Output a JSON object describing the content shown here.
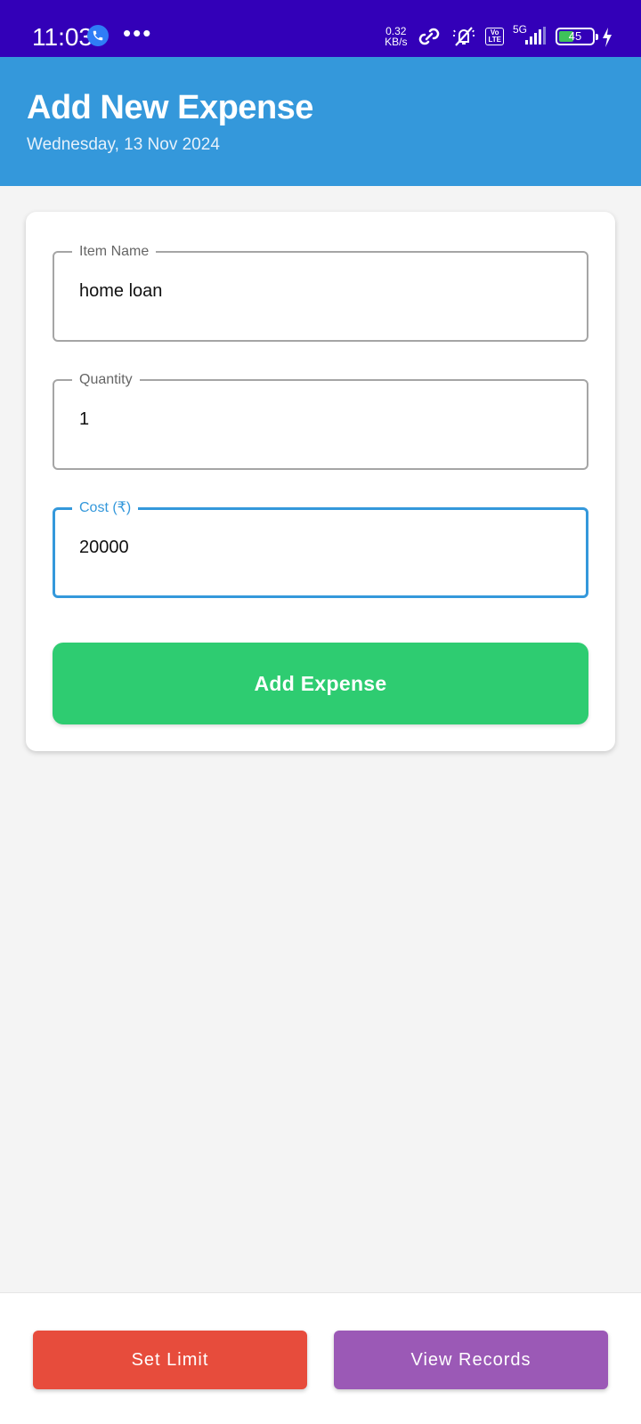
{
  "status_bar": {
    "time": "11:03",
    "more": "•••",
    "speed_value": "0.32",
    "speed_unit": "KB/s",
    "volte_top": "Vo",
    "volte_bottom": "LTE",
    "network": "5G",
    "battery": "45",
    "battery_level": 0.45,
    "colors": {
      "background": "#3300b8",
      "battery_fill": "#3ec25a",
      "call_badge": "#2f7df6"
    }
  },
  "header": {
    "title": "Add New Expense",
    "date": "Wednesday, 13 Nov 2024",
    "color": "#3498db"
  },
  "form": {
    "item_name": {
      "label": "Item Name",
      "value": "home loan"
    },
    "quantity": {
      "label": "Quantity",
      "value": "1"
    },
    "cost": {
      "label": "Cost (₹)",
      "value": "20000",
      "focused": true
    },
    "submit_label": "Add Expense",
    "submit_color": "#2ecc71"
  },
  "bottom_bar": {
    "set_limit_label": "Set Limit",
    "set_limit_color": "#e74c3c",
    "view_records_label": "View Records",
    "view_records_color": "#9b59b6"
  },
  "icons": [
    "phone-icon",
    "link-icon",
    "mute-icon",
    "signal-icon",
    "battery-icon",
    "charging-icon"
  ]
}
